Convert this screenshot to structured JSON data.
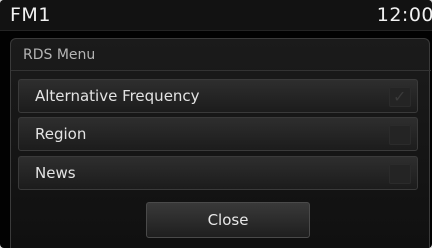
{
  "status_bar": {
    "title": "FM1",
    "time": "12:00"
  },
  "dialog": {
    "title": "RDS Menu",
    "items": [
      {
        "label": "Alternative Frequency",
        "checked": true
      },
      {
        "label": "Region",
        "checked": false
      },
      {
        "label": "News",
        "checked": false
      }
    ],
    "close_label": "Close"
  },
  "colors": {
    "background": "#020202",
    "row": "#2e2e2e",
    "text": "#e3e3e3",
    "muted_text": "#b5b5b5"
  },
  "icons": {
    "checked_item": "check-icon",
    "checkbox": "checkbox-icon"
  }
}
